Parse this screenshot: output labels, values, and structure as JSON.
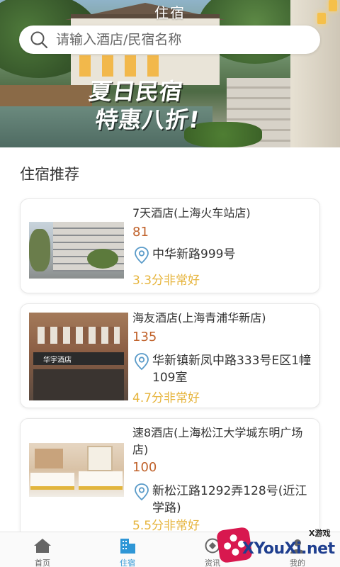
{
  "header": {
    "title": "住宿",
    "search_placeholder": "请输入酒店/民宿名称",
    "banner_line1": "夏日民宿",
    "banner_line2": "特惠八折!"
  },
  "section": {
    "title": "住宿推荐"
  },
  "hotels": [
    {
      "name": "7天酒店(上海火车站店)",
      "price": "81",
      "address": "中华新路999号",
      "rating": "3.3分非常好"
    },
    {
      "name": "海友酒店(上海青浦华新店)",
      "price": "135",
      "address": "华新镇新凤中路333号E区1幢109室",
      "rating": "4.7分非常好",
      "thumb_sign": "华宇酒店"
    },
    {
      "name": "速8酒店(上海松江大学城东明广场店)",
      "price": "100",
      "address": "新松江路1292弄128号(近江学路)",
      "rating": "5.5分非常好"
    }
  ],
  "tabbar": {
    "items": [
      {
        "label": "首页",
        "icon": "home-icon"
      },
      {
        "label": "住宿",
        "icon": "building-icon",
        "active": true
      },
      {
        "label": "资讯",
        "icon": "news-icon"
      },
      {
        "label": "我的",
        "icon": "user-icon"
      }
    ]
  },
  "watermark": {
    "small": "X游戏",
    "big": "XYouXi.net"
  },
  "colors": {
    "price": "#c0622b",
    "rating": "#e6b43c",
    "active_tab": "#2e96d6"
  }
}
